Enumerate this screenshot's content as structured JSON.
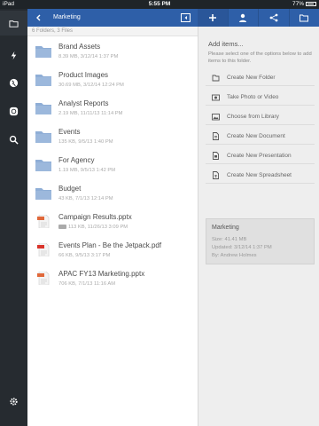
{
  "status_bar": {
    "carrier": "iPad",
    "time": "5:55 PM",
    "battery": "77%"
  },
  "nav_rail": {
    "icons": [
      "folder-icon",
      "bolt-icon",
      "globe-icon",
      "sync-icon",
      "search-icon",
      "settings-icon"
    ]
  },
  "header": {
    "title": "Marketing"
  },
  "listing": {
    "summary": "6 Folders, 3 Files",
    "items": [
      {
        "name": "Brand Assets",
        "meta": "8.39 MB, 3/12/14 1:37 PM",
        "type": "folder"
      },
      {
        "name": "Product Images",
        "meta": "30.69 MB, 3/12/14 12:24 PM",
        "type": "folder"
      },
      {
        "name": "Analyst Reports",
        "meta": "2.19 MB, 11/11/13 11:14 PM",
        "type": "folder"
      },
      {
        "name": "Events",
        "meta": "135 KB, 9/5/13 1:40 PM",
        "type": "folder"
      },
      {
        "name": "For Agency",
        "meta": "1.19 MB, 9/5/13 1:42 PM",
        "type": "folder"
      },
      {
        "name": "Budget",
        "meta": "43 KB, 7/1/13 12:14 PM",
        "type": "folder"
      },
      {
        "name": "Campaign Results.pptx",
        "meta": "113 KB, 11/26/13 3:09 PM",
        "type": "pptx"
      },
      {
        "name": "Events Plan - Be the Jetpack.pdf",
        "meta": "66 KB, 9/5/13 3:17 PM",
        "type": "pdf"
      },
      {
        "name": "APAC FY13 Marketing.pptx",
        "meta": "706 KB, 7/1/13 11:16 AM",
        "type": "pptx"
      }
    ]
  },
  "right_panel": {
    "tabs": [
      "plus-icon",
      "person-icon",
      "share-icon",
      "folder-icon"
    ],
    "add_title": "Add items...",
    "add_description": "Please select one of the options below to add items to this folder.",
    "actions": [
      {
        "label": "Create New Folder",
        "icon": "folder-icon"
      },
      {
        "label": "Take Photo or Video",
        "icon": "camera-icon"
      },
      {
        "label": "Choose from Library",
        "icon": "photo-library-icon"
      },
      {
        "label": "Create New Document",
        "icon": "document-icon"
      },
      {
        "label": "Create New Presentation",
        "icon": "presentation-icon"
      },
      {
        "label": "Create New Spreadsheet",
        "icon": "spreadsheet-icon"
      }
    ],
    "folder_info": {
      "name": "Marketing",
      "size": "Size: 41.41 MB",
      "updated": "Updated: 3/12/14 1:37 PM",
      "by": "By: Andrew Holmes"
    }
  },
  "colors": {
    "accent": "#2e5fa8",
    "rail": "#262b30",
    "folder": "#8faed6",
    "pptx": "#e0683a",
    "pdf": "#d9342b"
  }
}
